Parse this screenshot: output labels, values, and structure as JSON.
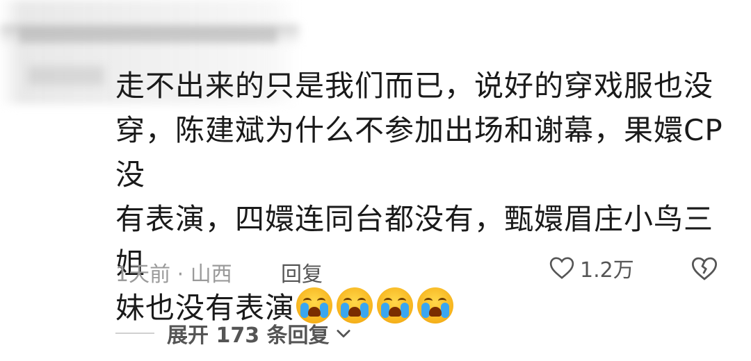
{
  "comment": {
    "lines": [
      "走不出来的只是我们而已，说好的穿戏服也没",
      "穿，陈建斌为什么不参加出场和谢幕，果嬛CP没",
      "有表演，四嬛连同台都没有，甄嬛眉庄小鸟三姐"
    ],
    "last_line": "妹也没有表演",
    "emojis": [
      "crying-face-icon",
      "crying-face-icon",
      "crying-face-icon",
      "crying-face-icon"
    ]
  },
  "meta": {
    "time_location": "1天前 · 山西",
    "reply_label": "回复",
    "like_count": "1.2万"
  },
  "expand": {
    "label": "展开 173 条回复"
  }
}
